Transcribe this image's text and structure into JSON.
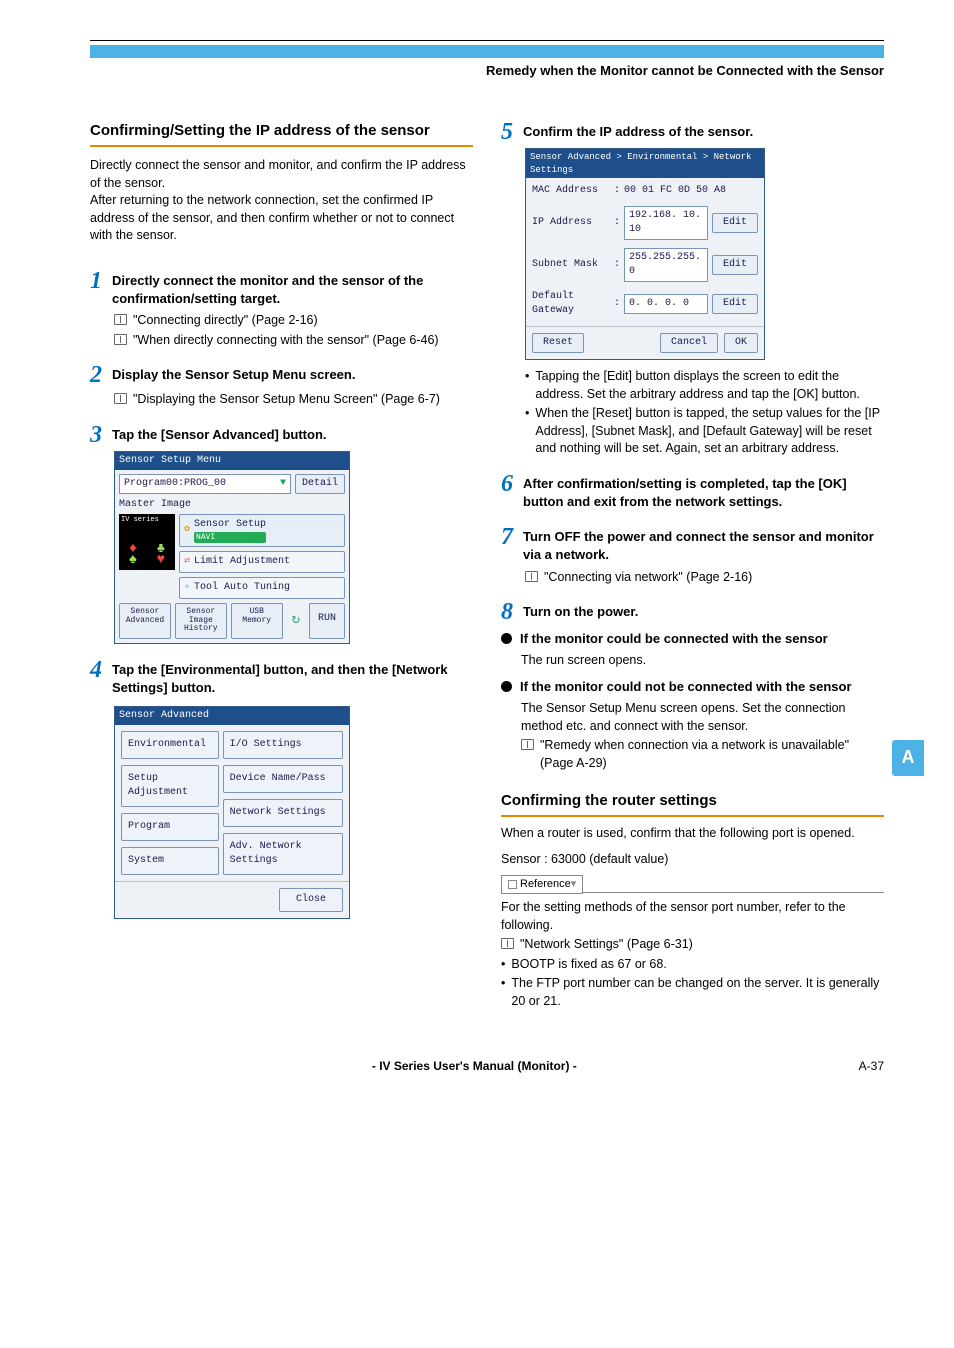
{
  "header": {
    "title": "Remedy when the Monitor cannot be Connected with the Sensor"
  },
  "side_tab": "A",
  "left": {
    "section_title": "Confirming/Setting the IP address of the sensor",
    "intro": "Directly connect the sensor and monitor, and confirm the IP address of the sensor.\nAfter returning to the network connection, set the confirmed IP address of the sensor, and then confirm whether or not to connect with the sensor.",
    "steps": {
      "s1_title": "Directly connect the monitor and the sensor of the confirmation/setting target.",
      "s1_ref1": "\"Connecting directly\" (Page 2-16)",
      "s1_ref2": "\"When directly connecting with the sensor\" (Page 6-46)",
      "s2_title": "Display the Sensor Setup Menu screen.",
      "s2_ref1": "\"Displaying the Sensor Setup Menu Screen\" (Page 6-7)",
      "s3_title": "Tap the [Sensor Advanced] button.",
      "s4_title": "Tap the [Environmental] button, and then the [Network Settings] button."
    },
    "ss1": {
      "bar": "Sensor Setup Menu",
      "program": "Program00:PROG_00",
      "detail": "Detail",
      "master": "Master Image",
      "thumb_label": "IV series",
      "sensor_setup": "Sensor Setup",
      "navi": "NAVI",
      "limit": "Limit Adjustment",
      "tool": "Tool Auto Tuning",
      "b1": "Sensor\nAdvanced",
      "b2": "Sensor\nImage\nHistory",
      "b3": "USB\nMemory",
      "run": "RUN"
    },
    "ss2": {
      "bar": "Sensor Advanced",
      "env": "Environmental",
      "io": "I/O Settings",
      "setup": "Setup Adjustment",
      "device": "Device Name/Pass",
      "program": "Program",
      "net": "Network Settings",
      "system": "System",
      "adv": "Adv. Network Settings",
      "close": "Close"
    }
  },
  "right": {
    "s5_title": "Confirm the IP address of the sensor.",
    "ss3": {
      "bar": "Sensor Advanced > Environmental > Network Settings",
      "mac_lbl": "MAC Address",
      "mac_val": "00 01 FC 0D 50 A8",
      "ip_lbl": "IP Address",
      "ip_val": "192.168. 10. 10",
      "subnet_lbl": "Subnet Mask",
      "subnet_val": "255.255.255.  0",
      "gw_lbl": "Default Gateway",
      "gw_val": "  0.  0.  0.  0",
      "edit": "Edit",
      "reset": "Reset",
      "cancel": "Cancel",
      "ok": "OK"
    },
    "s5_b1": "Tapping the [Edit] button displays the screen to edit the address. Set the arbitrary address and tap the [OK] button.",
    "s5_b2": "When the [Reset] button is tapped, the setup values for the [IP Address], [Subnet Mask], and [Default Gateway] will be reset and nothing will be set. Again, set an arbitrary address.",
    "s6_title": "After confirmation/setting is completed, tap the [OK] button and exit from the network settings.",
    "s7_title": "Turn OFF the power and connect the sensor and monitor via a network.",
    "s7_ref": "\"Connecting via network\" (Page 2-16)",
    "s8_title": "Turn on the power.",
    "bb1_title": "If the monitor could be connected with the sensor",
    "bb1_body": "The run screen opens.",
    "bb2_title": "If the monitor could not be connected with the sensor",
    "bb2_body": "The Sensor Setup Menu screen opens. Set the connection method etc. and connect with the sensor.",
    "bb2_ref": "\"Remedy when connection via a network is unavailable\" (Page A-29)",
    "router_title": "Confirming the router settings",
    "router_intro": "When a router is used, confirm that the following port is opened.",
    "router_port": "Sensor : 63000 (default value)",
    "reference_label": "Reference",
    "ref_body1": "For the setting methods of the sensor port number, refer to the following.",
    "ref_ref": "\"Network Settings\" (Page 6-31)",
    "ref_b1": "BOOTP is fixed as 67 or 68.",
    "ref_b2": "The FTP port number can be changed on the server. It is generally 20 or 21."
  },
  "footer": {
    "center": "- IV Series User's Manual (Monitor) -",
    "right": "A-37"
  }
}
